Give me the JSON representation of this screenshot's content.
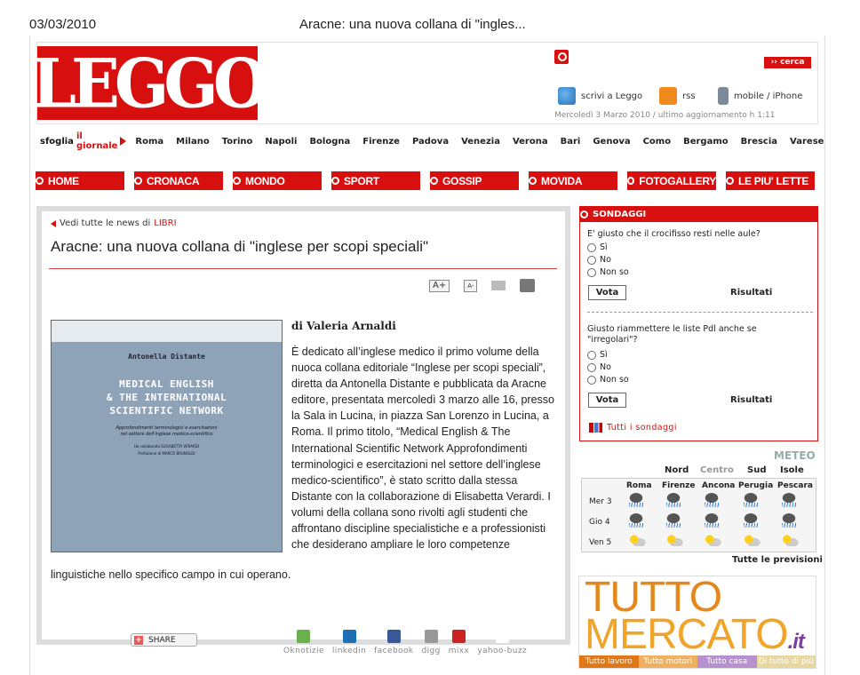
{
  "print_header": {
    "date": "03/03/2010",
    "title": "Aracne: una nuova collana di \"ingles..."
  },
  "header": {
    "logo_text": "LEGGO",
    "search_button": "›› cerca",
    "links": {
      "scrivi": "scrivi a Leggo",
      "rss": "rss",
      "mobile": "mobile / iPhone"
    },
    "updated": "Mercoledì 3 Marzo 2010  /  ultimo aggiornamento h 1:11"
  },
  "cities": {
    "sfoglia_a": "sfoglia",
    "sfoglia_b": "il giornale",
    "items": [
      "Roma",
      "Milano",
      "Torino",
      "Napoli",
      "Bologna",
      "Firenze",
      "Padova",
      "Venezia",
      "Verona",
      "Bari",
      "Genova",
      "Como",
      "Bergamo",
      "Brescia",
      "Varese"
    ]
  },
  "nav": [
    "HOME",
    "CRONACA",
    "MONDO",
    "SPORT",
    "GOSSIP",
    "MOVIDA",
    "FOTOGALLERY",
    "LE PIU' LETTE"
  ],
  "article": {
    "back_text": "Vedi tutte le news di",
    "back_category": "LIBRI",
    "title": "Aracne: una nuova collana di \"inglese per scopi speciali\"",
    "tools": {
      "font_up": "A+",
      "font_down": "A-"
    },
    "byline": "di Valeria Arnaldi",
    "body": "È dedicato all’inglese medico il primo volume della nuoca collana editoriale “Inglese per scopi speciali”, diretta da Antonella Distante e pubblicata da Aracne editore, presentata mercoledì 3 marzo alle 16, presso la Sala in Lucina, in piazza San Lorenzo in Lucina, a Roma. Il primo titolo, “Medical English & The International Scientific Network Approfondimenti terminologici e esercitazioni nel settore dell’inglese medico-scientifico”, è stato scritto dalla stessa Distante con la collaborazione di Elisabetta Verardi. I volumi della collana sono rivolti agli studenti che affrontano discipline specialistiche e a professionisti che desiderano ampliare le loro competenze",
    "body_tail": "linguistiche nello specifico campo in cui operano.",
    "cover": {
      "author": "Antonella Distante",
      "title_lines": [
        "MEDICAL ENGLISH",
        "& THE INTERNATIONAL",
        "SCIENTIFIC NETWORK"
      ],
      "subtitle": [
        "Approfondimenti terminologici e esercitazioni",
        "nel settore dell'inglese medico-scientifico"
      ],
      "collab": [
        "Ha collaborato ELISABETTA VERARDI",
        "Prefazione di MARCO BRUNOLDI"
      ]
    }
  },
  "share": {
    "button": "SHARE",
    "socials": [
      {
        "label": "Oknotizie",
        "color": "#6ab04c"
      },
      {
        "label": "linkedin",
        "color": "#1e6fb4"
      },
      {
        "label": "facebook",
        "color": "#3b5998"
      },
      {
        "label": "digg",
        "color": "#999999"
      },
      {
        "label": "mixx",
        "color": "#cc2222"
      },
      {
        "label": "yahoo-buzz",
        "color": "#ffffff"
      }
    ]
  },
  "poll": {
    "header": "SONDAGGI",
    "q1": "E' giusto che il crocifisso resti nelle aule?",
    "q2_line1": "Giusto riammettere le liste Pdl anche se",
    "q2_line2": "\"irregolari\"?",
    "options": [
      "Sì",
      "No",
      "Non so"
    ],
    "vota": "Vota",
    "risultati": "Risultati",
    "tutti": "Tutti i sondaggi"
  },
  "meteo": {
    "title": "METEO",
    "regions": [
      "Nord",
      "Centro",
      "Sud",
      "Isole"
    ],
    "cities": [
      "Roma",
      "Firenze",
      "Ancona",
      "Perugia",
      "Pescara"
    ],
    "days": [
      "Mer 3",
      "Gio 4",
      "Ven 5"
    ],
    "conditions": [
      [
        "rain",
        "rain",
        "rain",
        "rain",
        "rain"
      ],
      [
        "rain",
        "rain",
        "rain",
        "rain",
        "rain"
      ],
      [
        "sun",
        "sun",
        "sun",
        "sun",
        "sun"
      ]
    ],
    "link": "Tutte le previsioni"
  },
  "ad": {
    "line1": "TUTTO",
    "line2": "MERCATO",
    "tld": ".it",
    "tabs": [
      "Tutto lavoro",
      "Tutto motori",
      "Tutto casa",
      "Di tutto di più"
    ],
    "tab_colors": [
      "#e07818",
      "#f0b060",
      "#b890d0",
      "#e8d8a0"
    ]
  }
}
